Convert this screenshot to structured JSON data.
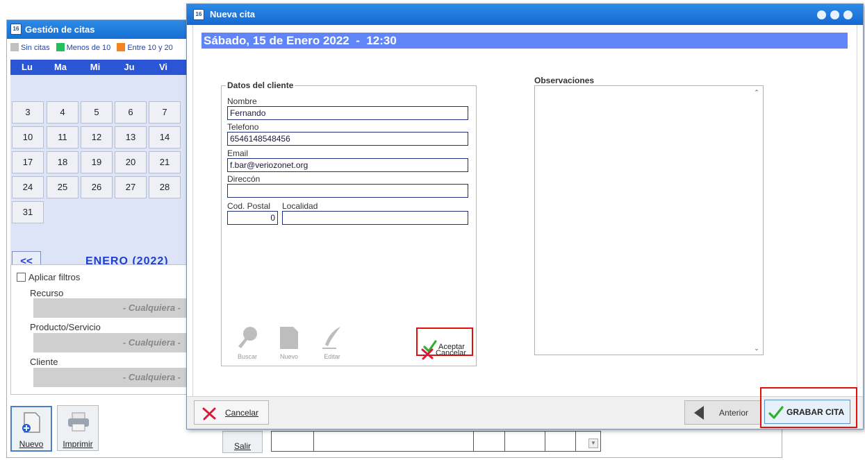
{
  "background_window": {
    "title": "Gestión de citas",
    "icon": "calendar-icon",
    "legend": [
      {
        "label": "Sin citas",
        "color": "#c0c0c0"
      },
      {
        "label": "Menos de 10",
        "color": "#22c05a"
      },
      {
        "label": "Entre 10 y 20",
        "color": "#f58220"
      }
    ],
    "weekdays": [
      "Lu",
      "Ma",
      "Mi",
      "Ju",
      "Vi"
    ],
    "weeks": [
      [
        "3",
        "4",
        "5",
        "6",
        "7"
      ],
      [
        "10",
        "11",
        "12",
        "13",
        "14"
      ],
      [
        "17",
        "18",
        "19",
        "20",
        "21"
      ],
      [
        "24",
        "25",
        "26",
        "27",
        "28"
      ],
      [
        "31"
      ]
    ],
    "prev_label": "<<",
    "month_label": "ENERO  (2022)",
    "filters": {
      "apply_label": "Aplicar filtros",
      "apply_checked": false,
      "recurso_label": "Recurso",
      "recurso_value": "- Cualquiera -",
      "producto_label": "Producto/Servicio",
      "producto_value": "- Cualquiera -",
      "cliente_label": "Cliente",
      "cliente_value": "- Cualquiera -"
    },
    "toolbar": {
      "nuevo_label": "Nuevo",
      "imprimir_label": "Imprimir",
      "salir_label": "Salir"
    }
  },
  "dialog": {
    "title": "Nueva cita",
    "date_line": "Sábado, 15 de Enero 2022  -  12:30",
    "client_group_label": "Datos del cliente",
    "fields": {
      "nombre_label": "Nombre",
      "nombre_value": "Fernando",
      "telefono_label": "Telefono",
      "telefono_value": "6546148548456",
      "email_label": "Email",
      "email_value": "f.bar@veriozonet.org",
      "direccion_label": "Direccón",
      "direccion_value": "",
      "cod_postal_label": "Cod. Postal",
      "cod_postal_value": "0",
      "localidad_label": "Localidad",
      "localidad_value": ""
    },
    "actions": {
      "buscar": "Buscar",
      "nuevo": "Nuevo",
      "editar": "Editar",
      "aceptar": "Aceptar",
      "cancelar": "Cancelar"
    },
    "observaciones_label": "Observaciones",
    "observaciones_value": "",
    "footer": {
      "cancelar": "Cancelar",
      "anterior": "Anterior",
      "grabar": "GRABAR CITA"
    }
  },
  "colors": {
    "title_bar": "#1e78dc",
    "date_bar": "#5f85f8",
    "calendar_header": "#2a55d4",
    "highlight": "#e01010",
    "check_green": "#2fae2f",
    "cancel_red": "#d81b3c"
  }
}
